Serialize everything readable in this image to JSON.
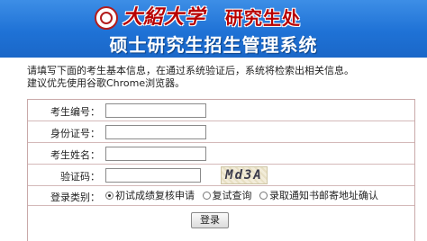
{
  "header": {
    "university": "大紹大学",
    "office": "研究生处",
    "system_title": "硕士研究生招生管理系统"
  },
  "notice": {
    "line1": "请填写下面的考生基本信息，在通过系统验证后，系统将检索出相关信息。",
    "line2": "建议优先使用谷歌Chrome浏览器。"
  },
  "form": {
    "exam_id_label": "考生编号：",
    "exam_id_value": "",
    "id_card_label": "身份证号：",
    "id_card_value": "",
    "name_label": "考生姓名：",
    "name_value": "",
    "captcha_label": "验证码：",
    "captcha_value": "",
    "captcha_text": "Md3A",
    "login_type_label": "登录类别：",
    "login_types": [
      {
        "label": "初试成绩复核申请",
        "checked": true
      },
      {
        "label": "复试查询",
        "checked": false
      },
      {
        "label": "录取通知书邮寄地址确认",
        "checked": false
      }
    ],
    "login_button": "登录"
  },
  "colors": {
    "header_blue": "#1f72d6",
    "brand_red": "#b80000",
    "table_border": "#c9a9a9"
  }
}
